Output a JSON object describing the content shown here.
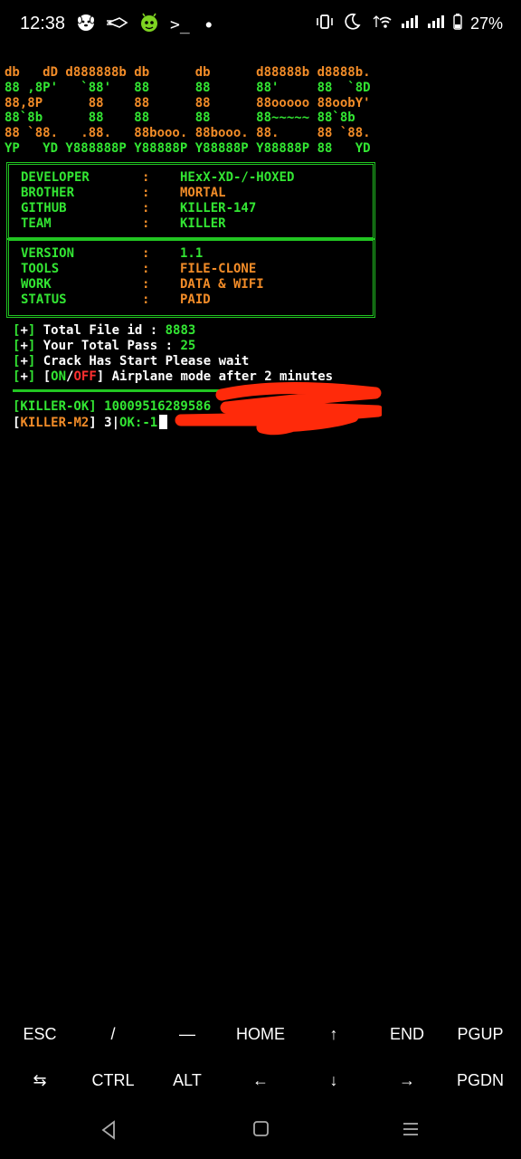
{
  "status_bar": {
    "time": "12:38",
    "battery": "27%",
    "left_icons": [
      "dog-app-icon",
      "rocket-icon",
      "android-icon",
      "terminal-icon",
      "dot-icon"
    ],
    "right_icons": [
      "vibrate-icon",
      "moon-icon",
      "wifi-icon",
      "signal-icon",
      "signal-icon",
      "battery-icon"
    ]
  },
  "banner": [
    [
      {
        "t": "db   dD d888888b db      db      d88888b d8888b.",
        "c": "o"
      }
    ],
    [
      {
        "t": "88 ,8P'   `88'   88      88      88'     88  `8D",
        "c": "g"
      }
    ],
    [
      {
        "t": "88,8P      88    88      88      88ooooo 88oobY'",
        "c": "o"
      }
    ],
    [
      {
        "t": "88`8b      88    88      88      88~~~~~ 88`8b",
        "c": "g"
      }
    ],
    [
      {
        "t": "88 `88.   .88.   88booo. 88booo. 88.     88 `88.",
        "c": "o"
      }
    ],
    [
      {
        "t": "YP   YD Y888888P Y88888P Y88888P Y88888P 88   YD",
        "c": "g"
      }
    ]
  ],
  "box1": [
    {
      "label": "DEVELOPER",
      "sep": ":",
      "value": "HExX-XD-/-HOXED",
      "vc": "g"
    },
    {
      "label": "BROTHER",
      "sep": ":",
      "value": "MORTAL",
      "vc": "o"
    },
    {
      "label": "GITHUB",
      "sep": ":",
      "value": "KILLER-147",
      "vc": "g"
    },
    {
      "label": "TEAM",
      "sep": ":",
      "value": "KILLER",
      "vc": "g"
    }
  ],
  "box2": [
    {
      "label": "VERSION",
      "sep": ":",
      "value": "1.1",
      "vc": "g"
    },
    {
      "label": "TOOLS",
      "sep": ":",
      "value": "FILE-CLONE",
      "vc": "o"
    },
    {
      "label": "WORK",
      "sep": ":",
      "value": "DATA & WIFI",
      "vc": "o"
    },
    {
      "label": "STATUS",
      "sep": ":",
      "value": "PAID",
      "vc": "o"
    }
  ],
  "info": {
    "bracket_open": "[",
    "plus": "+",
    "bracket_close": "]",
    "line1_label": " Total File id : ",
    "line1_value": "8883",
    "line2_label": " Your Total Pass : ",
    "line2_value": "25",
    "line3_text": " Crack Has Start Please wait",
    "line4_on": "ON",
    "line4_slash": "/",
    "line4_off": "OFF",
    "line4_rest": "] Airplane mode after 2 minutes"
  },
  "output": {
    "ok_tag": "[KILLER-OK]",
    "ok_id": " 10009516289586",
    "m2_open": "[",
    "m2_tag": "KILLER-M2",
    "m2_close": "]",
    "m2_count": " 3|",
    "ok_label": "OK:-1"
  },
  "extra_keys": {
    "row1": [
      "ESC",
      "/",
      "—",
      "HOME",
      "↑",
      "END",
      "PGUP"
    ],
    "row2": [
      "⇆",
      "CTRL",
      "ALT",
      "←",
      "↓",
      "→",
      "PGDN"
    ]
  },
  "nav_icons": [
    "back-icon",
    "home-icon",
    "recents-icon"
  ],
  "colors": {
    "orange": "#f28c28",
    "green": "#33e633",
    "red": "#ff3030",
    "border": "#22c522",
    "scribble": "#ff2a0a"
  }
}
